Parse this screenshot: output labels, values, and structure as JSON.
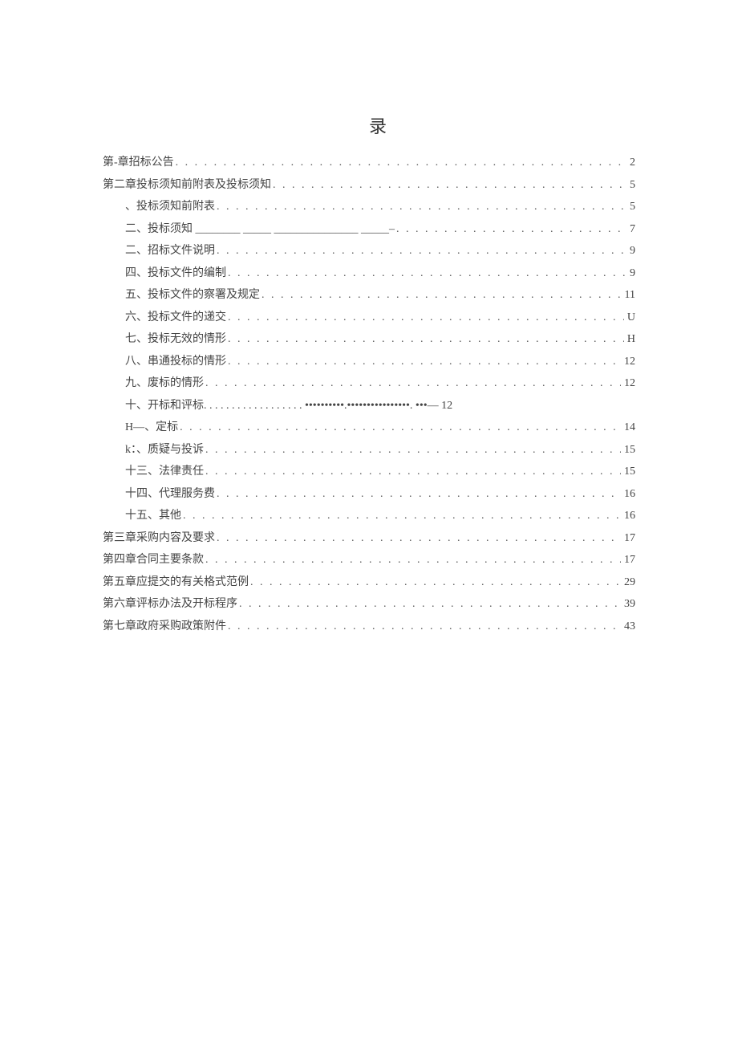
{
  "title": " 录",
  "toc": [
    {
      "label": "第-章招标公告",
      "page": "2",
      "indent": false,
      "leader": "dots"
    },
    {
      "label": "第二章投标须知前附表及投标须知",
      "page": "5",
      "indent": false,
      "leader": "dots"
    },
    {
      "label": "、投标须知前附表",
      "page": "5",
      "indent": true,
      "leader": "dots"
    },
    {
      "label": "二、投标须知 ________ _____ _______________ _____–",
      "page": "7",
      "indent": true,
      "leader": "dots"
    },
    {
      "label": "二、招标文件说明",
      "page": "9",
      "indent": true,
      "leader": "dots"
    },
    {
      "label": "四、投标文件的编制",
      "page": "9",
      "indent": true,
      "leader": "dots"
    },
    {
      "label": "五、投标文件的察署及规定",
      "page": "11",
      "indent": true,
      "leader": "dots"
    },
    {
      "label": "六、投标文件的递交",
      "page": "U",
      "indent": true,
      "leader": "dots"
    },
    {
      "label": "七、投标无效的情形",
      "page": "H",
      "indent": true,
      "leader": "dots"
    },
    {
      "label": "八、串通投标的情形",
      "page": "12",
      "indent": true,
      "leader": "dots"
    },
    {
      "label": "九、废标的情形",
      "page": "12",
      "indent": true,
      "leader": "dots"
    },
    {
      "label": "十、开标和评标. . . . . . . . . . . . .   . . .  . .  ••••••••••.••••••••••••••••. •••— 12",
      "page": "",
      "indent": true,
      "leader": "none"
    },
    {
      "label": "H—、定标",
      "page": "14",
      "indent": true,
      "leader": "dots"
    },
    {
      "label": "k：、质疑与投诉",
      "page": "15",
      "indent": true,
      "leader": "dots"
    },
    {
      "label": "十三、法律责任",
      "page": "15",
      "indent": true,
      "leader": "dots"
    },
    {
      "label": "十四、代理服务费",
      "page": "16",
      "indent": true,
      "leader": "dots"
    },
    {
      "label": "十五、其他",
      "page": "16",
      "indent": true,
      "leader": "dots"
    },
    {
      "label": "第三章采购内容及要求",
      "page": "17",
      "indent": false,
      "leader": "dots"
    },
    {
      "label": "第四章合同主要条款",
      "page": "17",
      "indent": false,
      "leader": "dots"
    },
    {
      "label": "第五章应提交的有关格式范例",
      "page": "29",
      "indent": false,
      "leader": "dots"
    },
    {
      "label": "第六章评标办法及开标程序",
      "page": "39",
      "indent": false,
      "leader": "dots"
    },
    {
      "label": "第七章政府采购政策附件",
      "page": "43",
      "indent": false,
      "leader": "dots"
    }
  ]
}
